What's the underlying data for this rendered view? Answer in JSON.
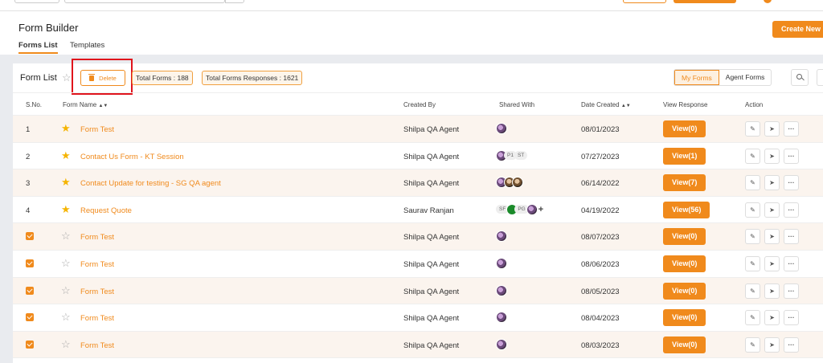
{
  "header": {
    "title": "Form Builder",
    "tabs": [
      "Forms List",
      "Templates"
    ],
    "create_label": "Create New"
  },
  "toolbar": {
    "title": "Form List",
    "delete_label": "Delete",
    "total_forms": "Total Forms : 188",
    "total_responses": "Total Forms Responses : 1621",
    "toggle": [
      "My Forms",
      "Agent Forms"
    ]
  },
  "table": {
    "headers": {
      "sno": "S.No.",
      "name": "Form Name",
      "created_by": "Created By",
      "shared_with": "Shared With",
      "date": "Date Created",
      "view": "View Response",
      "action": "Action"
    },
    "rows": [
      {
        "sno": "1",
        "checked": false,
        "fav": true,
        "name": "Form Test",
        "created_by": "Shilpa QA Agent",
        "date": "08/01/2023",
        "view": "View(0)"
      },
      {
        "sno": "2",
        "checked": false,
        "fav": true,
        "name": "Contact Us Form - KT Session",
        "created_by": "Shilpa QA Agent",
        "date": "07/27/2023",
        "view": "View(1)"
      },
      {
        "sno": "3",
        "checked": false,
        "fav": true,
        "name": "Contact Update for testing - SG QA agent",
        "created_by": "Shilpa QA Agent",
        "date": "06/14/2022",
        "view": "View(7)"
      },
      {
        "sno": "4",
        "checked": false,
        "fav": true,
        "name": "Request Quote",
        "created_by": "Saurav Ranjan",
        "date": "04/19/2022",
        "view": "View(56)"
      },
      {
        "sno": "",
        "checked": true,
        "fav": false,
        "name": "Form Test",
        "created_by": "Shilpa QA Agent",
        "date": "08/07/2023",
        "view": "View(0)"
      },
      {
        "sno": "",
        "checked": true,
        "fav": false,
        "name": "Form Test",
        "created_by": "Shilpa QA Agent",
        "date": "08/06/2023",
        "view": "View(0)"
      },
      {
        "sno": "",
        "checked": true,
        "fav": false,
        "name": "Form Test",
        "created_by": "Shilpa QA Agent",
        "date": "08/05/2023",
        "view": "View(0)"
      },
      {
        "sno": "",
        "checked": true,
        "fav": false,
        "name": "Form Test",
        "created_by": "Shilpa QA Agent",
        "date": "08/04/2023",
        "view": "View(0)"
      },
      {
        "sno": "",
        "checked": true,
        "fav": false,
        "name": "Form Test",
        "created_by": "Shilpa QA Agent",
        "date": "08/03/2023",
        "view": "View(0)"
      }
    ],
    "shared_row2_initials": [
      "P1",
      "ST"
    ],
    "shared_row4_initials": [
      "SF",
      "PG"
    ]
  },
  "colors": {
    "accent": "#f08a1c",
    "highlight": "#e0141c",
    "star": "#f5b400"
  }
}
